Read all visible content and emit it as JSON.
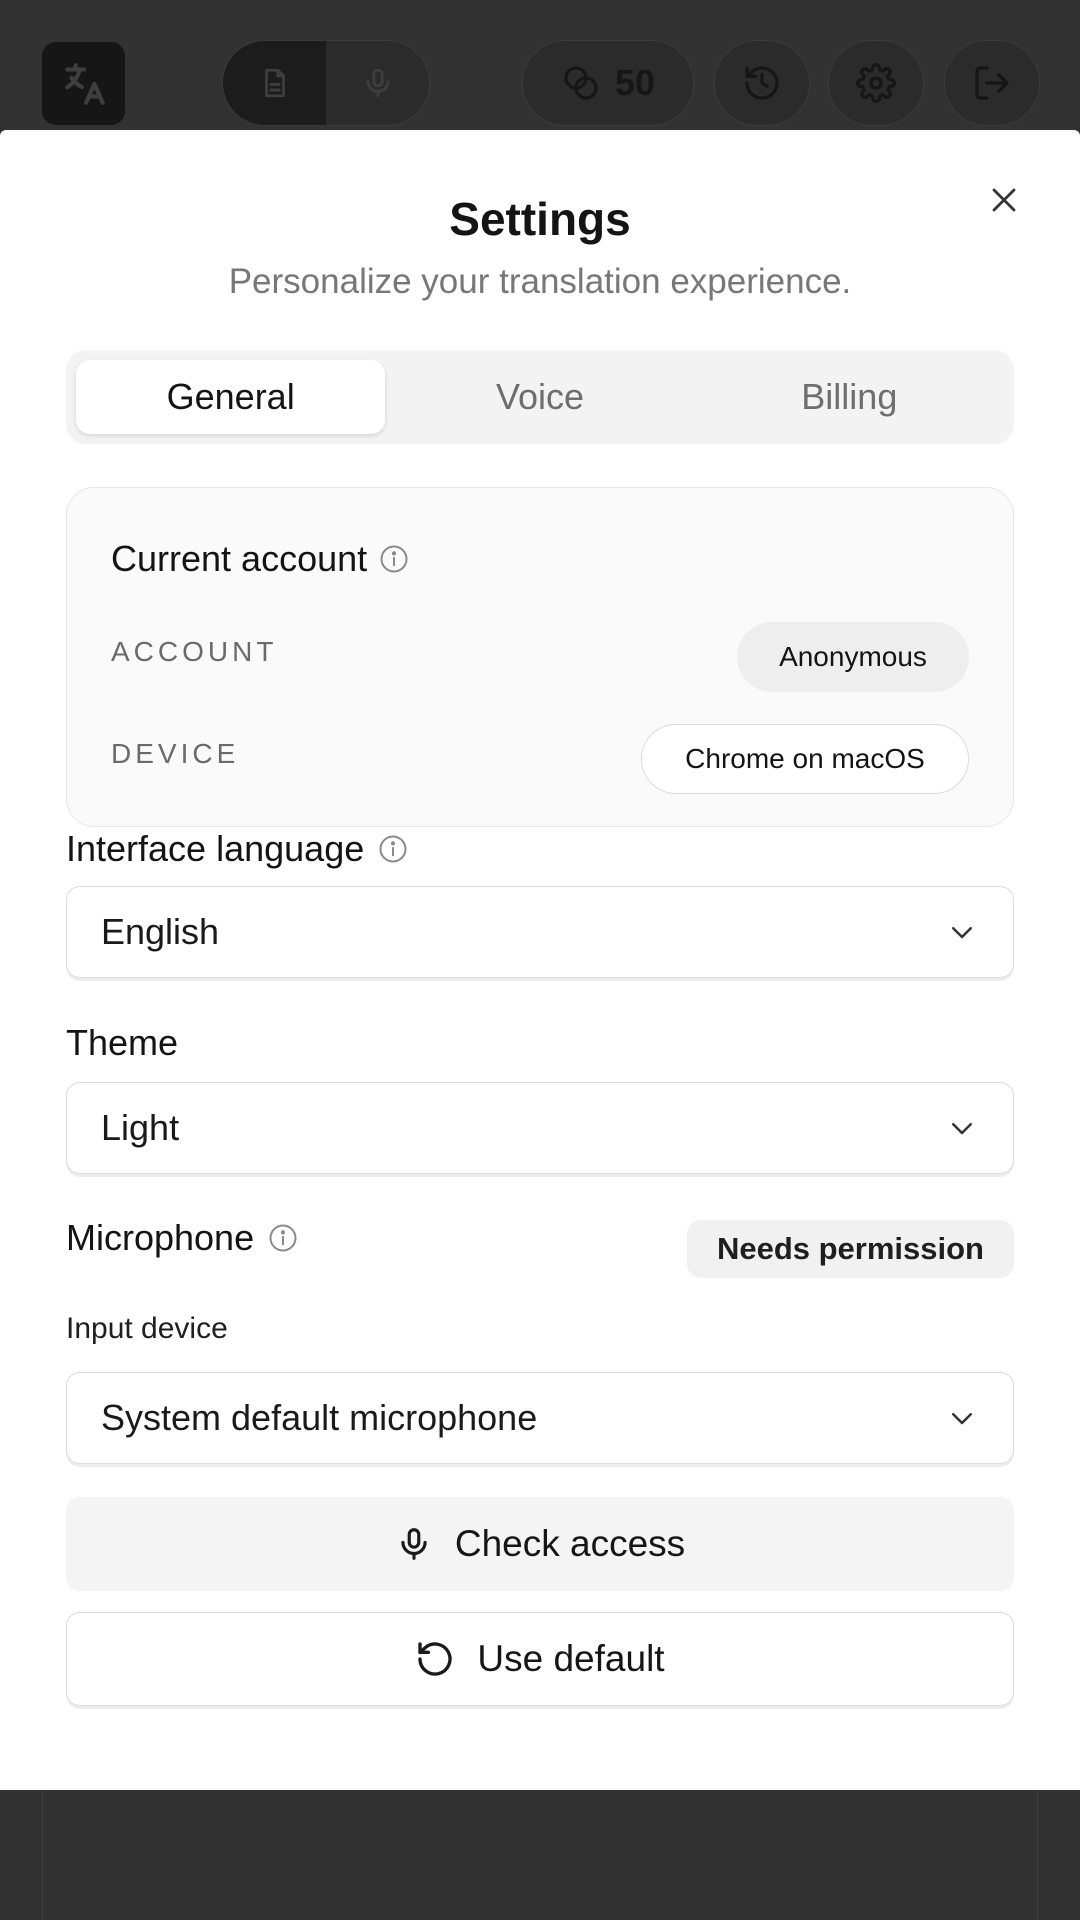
{
  "toolbar": {
    "credits_value": "50",
    "icons": [
      "translate-icon",
      "document-icon",
      "microphone-icon",
      "coins-icon",
      "history-icon",
      "gear-icon",
      "logout-icon"
    ]
  },
  "dialog": {
    "title": "Settings",
    "subtitle": "Personalize your translation experience."
  },
  "tabs": [
    {
      "label": "General",
      "active": true
    },
    {
      "label": "Voice",
      "active": false
    },
    {
      "label": "Billing",
      "active": false
    }
  ],
  "account_card": {
    "title": "Current account",
    "account_label": "ACCOUNT",
    "account_value": "Anonymous",
    "device_label": "DEVICE",
    "device_value": "Chrome on macOS"
  },
  "interface_language": {
    "label": "Interface language",
    "value": "English"
  },
  "theme": {
    "label": "Theme",
    "value": "Light"
  },
  "microphone": {
    "label": "Microphone",
    "status": "Needs permission",
    "input_device_label": "Input device",
    "input_device_value": "System default microphone",
    "check_access_label": "Check access",
    "use_default_label": "Use default"
  },
  "colors": {
    "backdrop": "#323232",
    "sheet": "#ffffff",
    "muted_text": "#777777",
    "border": "#dcdcdc"
  }
}
